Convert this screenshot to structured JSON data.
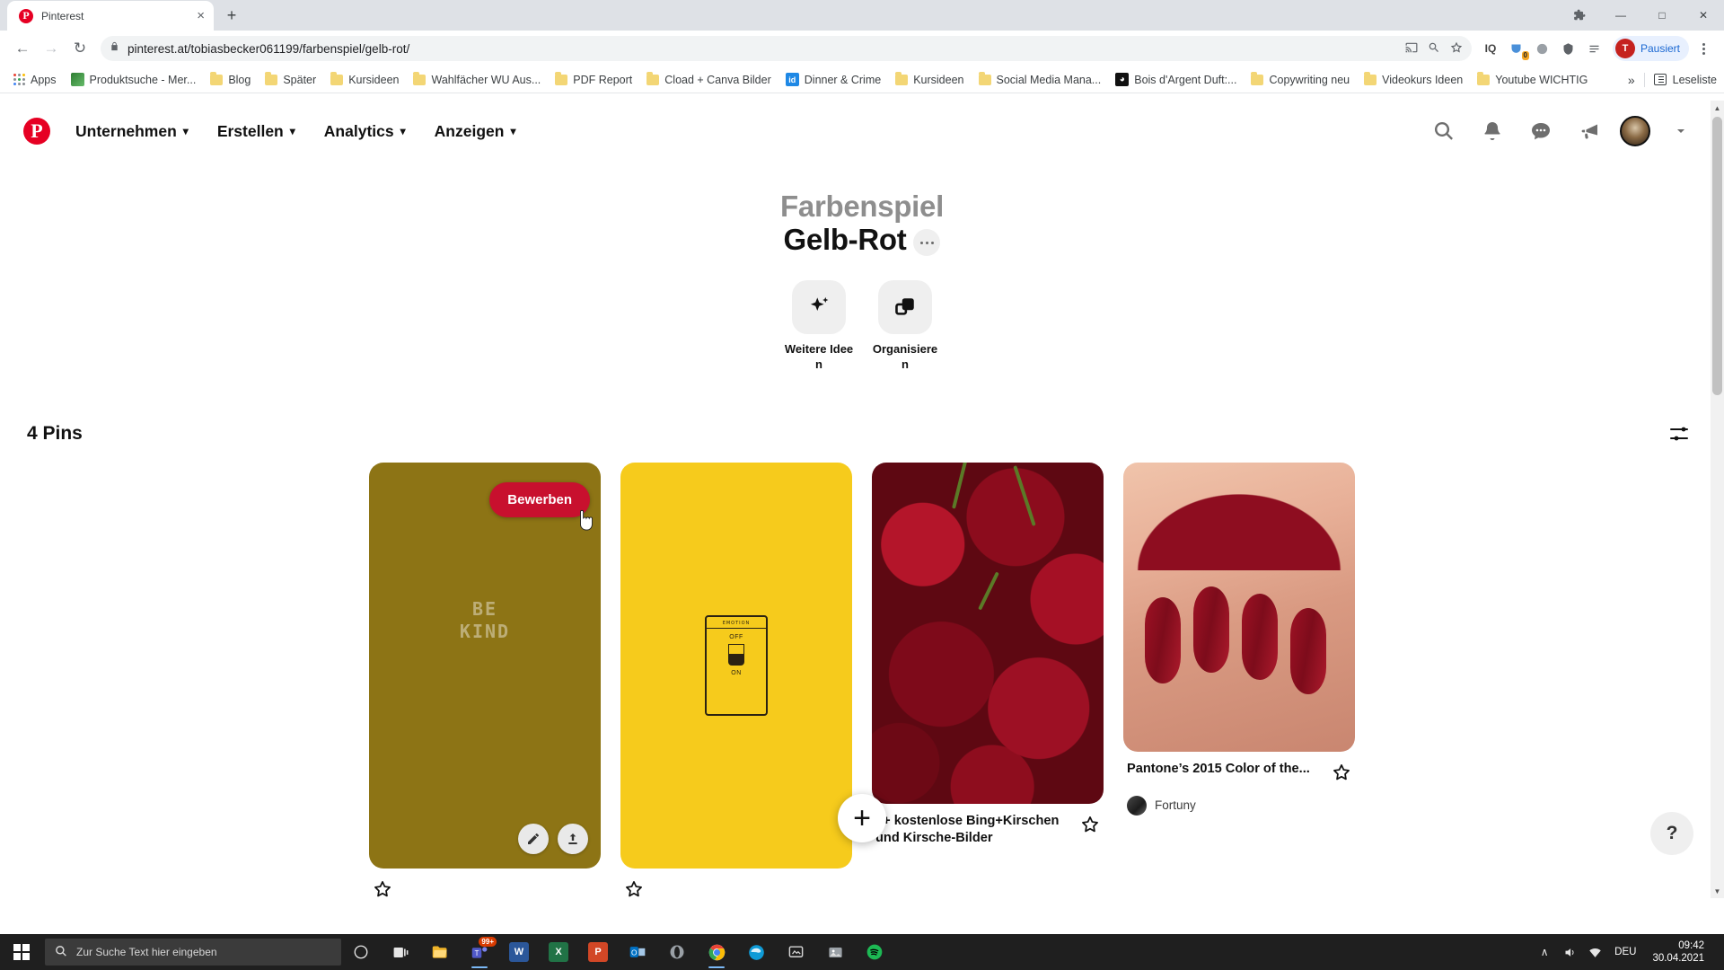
{
  "browser": {
    "tab": {
      "title": "Pinterest",
      "favicon": "pinterest-icon",
      "close": "×"
    },
    "new_tab_label": "+",
    "window_controls": {
      "minimize": "—",
      "maximize": "□",
      "close": "✕"
    },
    "nav": {
      "back": "←",
      "forward": "→",
      "reload": "↻"
    },
    "omnibox": {
      "lock_icon": "lock-icon",
      "url": "pinterest.at/tobiasbecker061199/farbenspiel/gelb-rot/",
      "icons": [
        "cast-icon",
        "zoom-icon",
        "bookmark-star-icon"
      ]
    },
    "extensions": [
      {
        "name": "iq-extension",
        "label": "IQ"
      },
      {
        "name": "pocket-extension",
        "label": "◑",
        "badge": "0"
      },
      {
        "name": "grammarly-extension",
        "label": "●"
      },
      {
        "name": "adblock-extension",
        "label": "◉"
      },
      {
        "name": "list-extension",
        "label": "≡"
      }
    ],
    "profile": {
      "initial": "T",
      "label": "Pausiert"
    },
    "menu_icon": "kebab-menu-icon",
    "bookmarks": [
      {
        "label": "Apps",
        "icon": "apps-grid-icon"
      },
      {
        "label": "Produktsuche - Mer...",
        "icon": "site-icon",
        "color": "#2e7d32"
      },
      {
        "label": "Blog",
        "icon": "folder-icon"
      },
      {
        "label": "Später",
        "icon": "folder-icon"
      },
      {
        "label": "Kursideen",
        "icon": "folder-icon"
      },
      {
        "label": "Wahlfächer WU Aus...",
        "icon": "folder-icon"
      },
      {
        "label": "PDF Report",
        "icon": "folder-icon"
      },
      {
        "label": "Cload + Canva Bilder",
        "icon": "folder-icon"
      },
      {
        "label": "Dinner & Crime",
        "icon": "site-icon",
        "color": "#1e88e5",
        "text": "id"
      },
      {
        "label": "Kursideen",
        "icon": "folder-icon"
      },
      {
        "label": "Social Media Mana...",
        "icon": "folder-icon"
      },
      {
        "label": "Bois d'Argent Duft:...",
        "icon": "site-icon",
        "color": "#111111",
        "text": "◑"
      },
      {
        "label": "Copywriting neu",
        "icon": "folder-icon"
      },
      {
        "label": "Videokurs Ideen",
        "icon": "folder-icon"
      },
      {
        "label": "Youtube WICHTIG",
        "icon": "folder-icon"
      }
    ],
    "bookmarks_overflow": "»",
    "reading_list": "Leseliste"
  },
  "pinterest": {
    "logo": "P",
    "nav_items": [
      {
        "label": "Unternehmen",
        "has_chevron": true
      },
      {
        "label": "Erstellen",
        "has_chevron": true
      },
      {
        "label": "Analytics",
        "has_chevron": true
      },
      {
        "label": "Anzeigen",
        "has_chevron": true
      }
    ],
    "nav_icons": [
      "search-icon",
      "bell-icon",
      "chat-icon",
      "megaphone-icon"
    ],
    "avatar": "user-avatar",
    "account_chevron": "⌄",
    "board": {
      "title_line1": "Farbenspiel",
      "title_line2": "Gelb-Rot",
      "options_icon": "board-options-icon",
      "actions": [
        {
          "label": "Weitere Ideen",
          "icon": "sparkle-icon"
        },
        {
          "label": "Organisieren",
          "icon": "organize-icon"
        }
      ]
    },
    "pins_count_label": "4 Pins",
    "filter_icon": "filter-sliders-icon",
    "pins": [
      {
        "name": "pin-be-kind",
        "overlay_text": "BE\nKIND",
        "cta_label": "Bewerben",
        "background": "#8d7415",
        "tools": [
          "edit-pencil-icon",
          "share-upload-icon"
        ],
        "save_icon": "star-icon"
      },
      {
        "name": "pin-emotion-jar",
        "background": "#f6cb1c",
        "label_top": "EMOTION",
        "label_off": "OFF",
        "label_on": "ON",
        "save_icon": "star-icon"
      },
      {
        "name": "pin-cherries",
        "title": "2+ kostenlose Bing+Kirschen und Kirsche-Bilder",
        "save_icon": "star-icon"
      },
      {
        "name": "pin-pantone-nails",
        "title": "Pantone’s 2015 Color of the...",
        "user": "Fortuny",
        "save_icon": "star-icon"
      }
    ],
    "create_fab": "+",
    "help_fab": "?"
  },
  "taskbar": {
    "start": "windows-start-icon",
    "search_placeholder": "Zur Suche Text hier eingeben",
    "search_icon": "search-icon",
    "items": [
      {
        "name": "cortana-icon",
        "glyph": "○",
        "color": "transparent"
      },
      {
        "name": "task-view-icon",
        "glyph": "▣",
        "color": "transparent"
      },
      {
        "name": "file-explorer-icon",
        "glyph": "🗀",
        "color": "#f0b429"
      },
      {
        "name": "teams-icon",
        "glyph": "99+",
        "color": "#5059c9",
        "badge": "99+"
      },
      {
        "name": "word-icon",
        "glyph": "W",
        "color": "#2b579a"
      },
      {
        "name": "excel-icon",
        "glyph": "X",
        "color": "#217346"
      },
      {
        "name": "powerpoint-icon",
        "glyph": "P",
        "color": "#d24726"
      },
      {
        "name": "outlook-icon",
        "glyph": "O",
        "color": "#0072c6"
      },
      {
        "name": "opera-icon",
        "glyph": "O",
        "color": "#8a8a8a"
      },
      {
        "name": "chrome-icon",
        "glyph": "●",
        "color": "#4285f4"
      },
      {
        "name": "edge-icon",
        "glyph": "e",
        "color": "#0f9bd7"
      },
      {
        "name": "snip-icon",
        "glyph": "✂",
        "color": "#7a7a7a"
      },
      {
        "name": "photos-icon",
        "glyph": "▦",
        "color": "#8a8a8a"
      },
      {
        "name": "spotify-icon",
        "glyph": "♫",
        "color": "#1db954"
      }
    ],
    "tray": {
      "chevron": "∧",
      "volume": "volume-icon",
      "network": "network-icon",
      "language": "DEU",
      "time": "09:42",
      "date": "30.04.2021"
    }
  }
}
